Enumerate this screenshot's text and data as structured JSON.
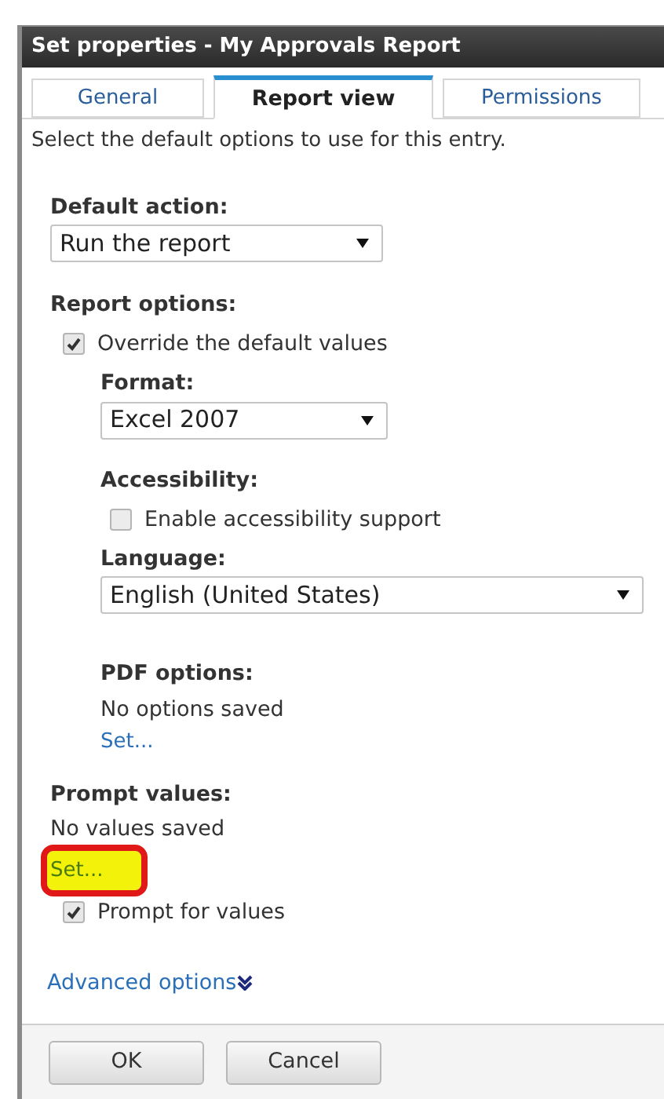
{
  "window": {
    "title": "Set properties - My Approvals Report"
  },
  "tabs": [
    {
      "label": "General",
      "selected": false
    },
    {
      "label": "Report view",
      "selected": true
    },
    {
      "label": "Permissions",
      "selected": false
    }
  ],
  "description": "Select the default options to use for this entry.",
  "default_action": {
    "label": "Default action:",
    "value": "Run the report"
  },
  "report_options": {
    "label": "Report options:",
    "override": {
      "label": "Override the default values",
      "checked": true
    },
    "format": {
      "label": "Format:",
      "value": "Excel 2007"
    },
    "accessibility": {
      "label": "Accessibility:",
      "option": {
        "label": "Enable accessibility support",
        "checked": false
      }
    },
    "language": {
      "label": "Language:",
      "value": "English (United States)"
    },
    "pdf_options": {
      "label": "PDF options:",
      "status": "No options saved",
      "link": {
        "label": "Set...",
        "highlighted": false
      }
    }
  },
  "prompt_values": {
    "label": "Prompt values:",
    "status": "No values saved",
    "link": {
      "label": "Set...",
      "highlighted": true
    },
    "prompt": {
      "label": "Prompt for values",
      "checked": true
    }
  },
  "advanced_options": {
    "label": "Advanced options",
    "expanded": false
  },
  "buttons": [
    "OK",
    "Cancel"
  ]
}
